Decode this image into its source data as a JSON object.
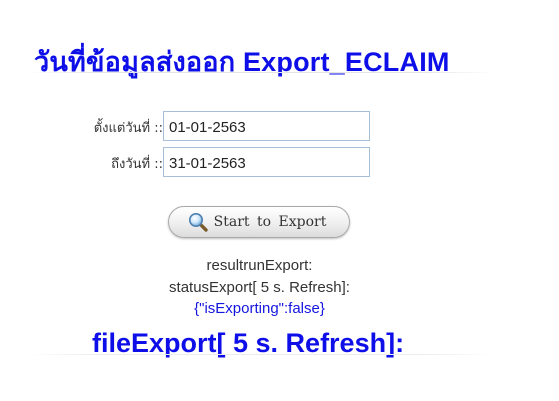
{
  "page": {
    "title": "วันที่ข้อมูลส่งออก Export_ECLAIM"
  },
  "form": {
    "start_date": {
      "label": "ตั้งแต่วันที่ ::",
      "value": "01-01-2563"
    },
    "end_date": {
      "label": "ถึงวันที่ ::",
      "value": "31-01-2563"
    }
  },
  "export_button": {
    "label": "Start to Export",
    "icon": "magnifier-icon"
  },
  "status": {
    "result_line": "resultrunExport:",
    "status_line": "statusExport[ 5 s. Refresh]:",
    "status_value": "{\"isExporting\":false}",
    "status_value_color": "#1515e0"
  },
  "file_export": {
    "title": "fileExport[ 5 s. Refresh]:"
  },
  "colors": {
    "heading": "#0e0ee8",
    "input_border": "#a6bfd6"
  }
}
